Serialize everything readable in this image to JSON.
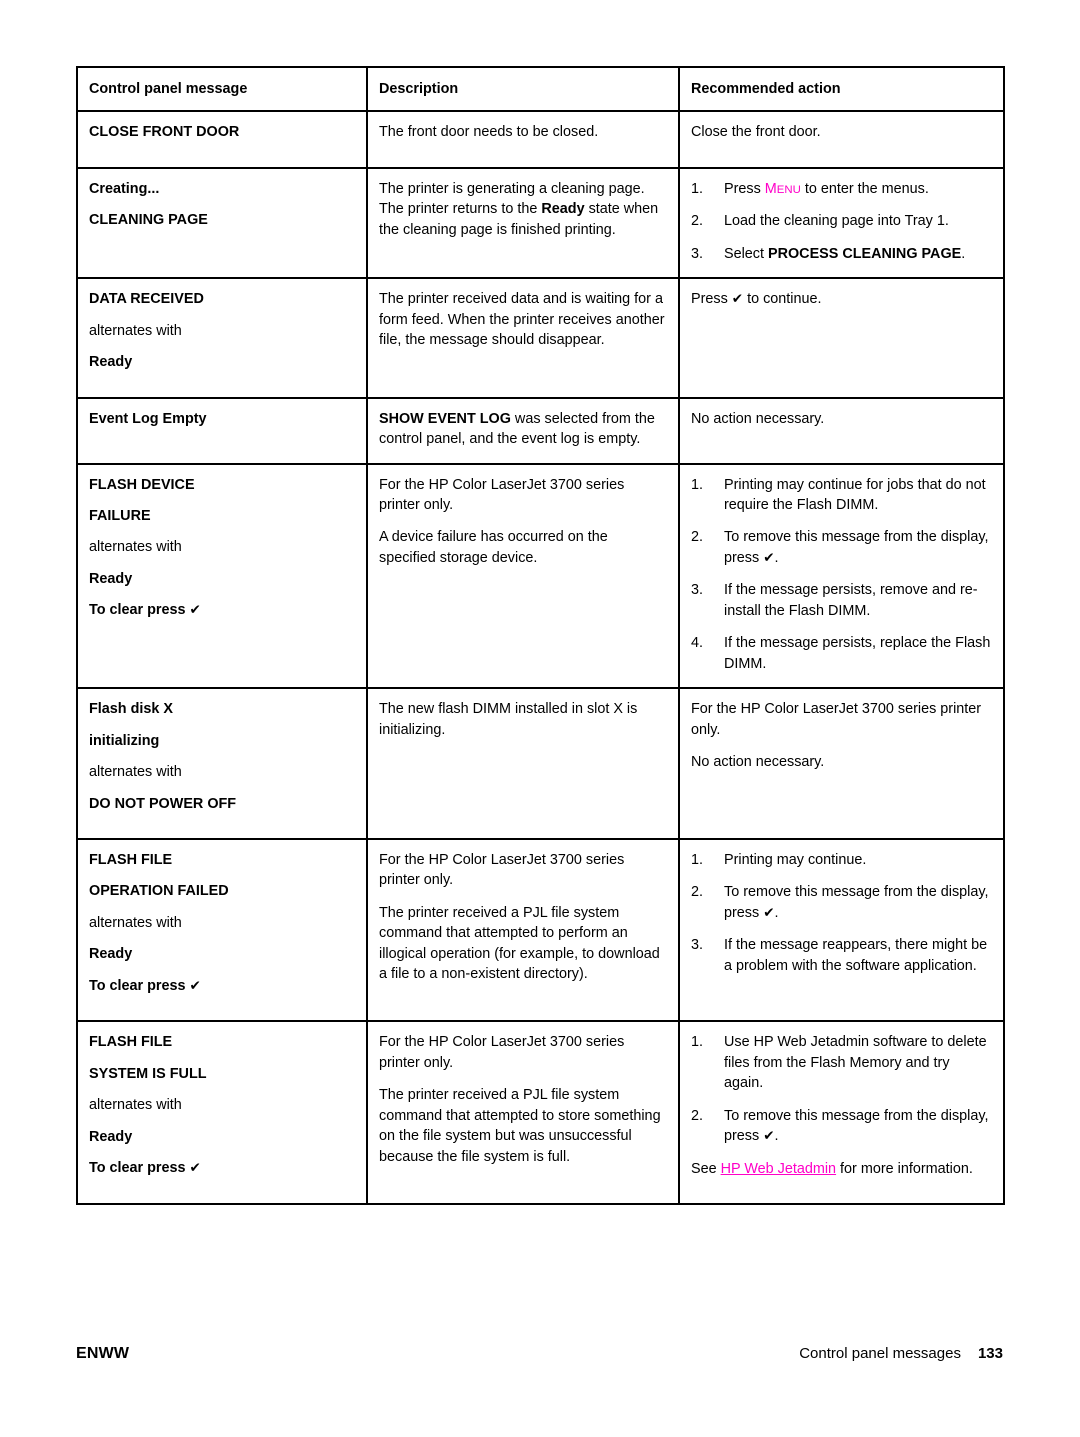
{
  "table": {
    "headers": [
      "Control panel message",
      "Description",
      "Recommended action"
    ],
    "rows": [
      {
        "message": {
          "lines": [
            {
              "text": "CLOSE FRONT DOOR",
              "bold": true
            }
          ]
        },
        "description": {
          "paragraphs": [
            "The front door needs to be closed."
          ]
        },
        "action": {
          "paragraphs": [
            "Close the front door."
          ]
        }
      },
      {
        "message": {
          "lines": [
            {
              "text": "Creating...",
              "bold": true
            },
            {
              "text": "CLEANING PAGE",
              "bold": true
            }
          ]
        },
        "description": {
          "paragraphs": [
            "The printer is generating a cleaning page. The printer returns to the Ready state when the cleaning page is finished printing."
          ],
          "rich": [
            {
              "t": "The printer is generating a cleaning page. The printer returns to the "
            },
            {
              "t": "Ready",
              "bold": true
            },
            {
              "t": " state when the cleaning page is finished printing."
            }
          ]
        },
        "action": {
          "steps": [
            {
              "rich": [
                {
                  "t": "Press "
                },
                {
                  "t": "Menu",
                  "key": true
                },
                {
                  "t": " to enter the menus."
                }
              ]
            },
            {
              "rich": [
                {
                  "t": "Load the cleaning page into Tray 1."
                }
              ]
            },
            {
              "rich": [
                {
                  "t": "Select "
                },
                {
                  "t": "PROCESS CLEANING PAGE",
                  "bold": true
                },
                {
                  "t": "."
                }
              ]
            }
          ]
        }
      },
      {
        "message": {
          "lines": [
            {
              "text": "DATA RECEIVED",
              "bold": true
            },
            {
              "text": "alternates with",
              "bold": false
            },
            {
              "text": "Ready",
              "bold": true
            }
          ]
        },
        "description": {
          "paragraphs": [
            "The printer received data and is waiting for a form feed. When the printer receives another file, the message should disappear."
          ]
        },
        "action": {
          "rich_paragraphs": [
            [
              {
                "t": "Press "
              },
              {
                "t": "✔",
                "check": true
              },
              {
                "t": " to continue."
              }
            ]
          ]
        }
      },
      {
        "message": {
          "lines": [
            {
              "text": "Event Log Empty",
              "bold": true
            }
          ]
        },
        "description": {
          "rich": [
            {
              "t": "SHOW EVENT LOG",
              "bold": true
            },
            {
              "t": " was selected from the control panel, and the event log is empty."
            }
          ]
        },
        "action": {
          "paragraphs": [
            "No action necessary."
          ]
        }
      },
      {
        "message": {
          "lines": [
            {
              "text": "FLASH DEVICE",
              "bold": true
            },
            {
              "text": "FAILURE",
              "bold": true
            },
            {
              "text": "alternates with",
              "bold": false
            },
            {
              "text": "Ready",
              "bold": true
            },
            {
              "text": "To clear press ✔",
              "bold": true,
              "check_suffix": true
            }
          ]
        },
        "description": {
          "paragraphs": [
            "For the HP Color LaserJet 3700 series printer only.",
            "A device failure has occurred on the specified storage device."
          ]
        },
        "action": {
          "steps": [
            {
              "rich": [
                {
                  "t": "Printing may continue for jobs that do not require the Flash DIMM."
                }
              ]
            },
            {
              "rich": [
                {
                  "t": "To remove this message from the display, press "
                },
                {
                  "t": "✔",
                  "check": true
                },
                {
                  "t": "."
                }
              ]
            },
            {
              "rich": [
                {
                  "t": "If the message persists, remove and re-install the Flash DIMM."
                }
              ]
            },
            {
              "rich": [
                {
                  "t": "If the message persists, replace the Flash DIMM."
                }
              ]
            }
          ]
        }
      },
      {
        "message": {
          "lines": [
            {
              "text": "Flash disk X",
              "bold": true
            },
            {
              "text": "initializing",
              "bold": true
            },
            {
              "text": "alternates with",
              "bold": false
            },
            {
              "text": "DO NOT POWER OFF",
              "bold": true
            }
          ]
        },
        "description": {
          "paragraphs": [
            "The new flash DIMM installed in slot X is initializing."
          ]
        },
        "action": {
          "paragraphs": [
            "For the HP Color LaserJet 3700 series printer only.",
            "No action necessary."
          ]
        }
      },
      {
        "message": {
          "lines": [
            {
              "text": "FLASH FILE",
              "bold": true
            },
            {
              "text": "OPERATION FAILED",
              "bold": true
            },
            {
              "text": "alternates with",
              "bold": false
            },
            {
              "text": "Ready",
              "bold": true
            },
            {
              "text": "To clear press ✔",
              "bold": true,
              "check_suffix": true
            }
          ]
        },
        "description": {
          "paragraphs": [
            "For the HP Color LaserJet 3700 series printer only.",
            "The printer received a PJL file system command that attempted to perform an illogical operation (for example, to download a file to a non-existent directory)."
          ]
        },
        "action": {
          "steps": [
            {
              "rich": [
                {
                  "t": "Printing may continue."
                }
              ]
            },
            {
              "rich": [
                {
                  "t": "To remove this message from the display, press "
                },
                {
                  "t": "✔",
                  "check": true
                },
                {
                  "t": "."
                }
              ]
            },
            {
              "rich": [
                {
                  "t": "If the message reappears, there might be a problem with the software application."
                }
              ]
            }
          ]
        }
      },
      {
        "message": {
          "lines": [
            {
              "text": "FLASH FILE",
              "bold": true
            },
            {
              "text": "SYSTEM IS FULL",
              "bold": true
            },
            {
              "text": "alternates with",
              "bold": false
            },
            {
              "text": "Ready",
              "bold": true
            },
            {
              "text": "To clear press ✔",
              "bold": true,
              "check_suffix": true
            }
          ]
        },
        "description": {
          "paragraphs": [
            "For the HP Color LaserJet 3700 series printer only.",
            "The printer received a PJL file system command that attempted to store something on the file system but was unsuccessful because the file system is full."
          ]
        },
        "action": {
          "steps": [
            {
              "rich": [
                {
                  "t": "Use HP Web Jetadmin software to delete files from the Flash Memory and try again."
                }
              ]
            },
            {
              "rich": [
                {
                  "t": "To remove this message from the display, press "
                },
                {
                  "t": "✔",
                  "check": true
                },
                {
                  "t": "."
                }
              ]
            }
          ],
          "after_steps": [
            {
              "t": "See "
            },
            {
              "t": "HP Web Jetadmin",
              "link": true
            },
            {
              "t": " for more information."
            }
          ]
        }
      }
    ]
  },
  "footer": {
    "left": "ENWW",
    "section": "Control panel messages",
    "page_number": "133"
  },
  "colors": {
    "accent": "#ff00c8",
    "text": "#000000",
    "border": "#000000",
    "background": "#ffffff"
  }
}
